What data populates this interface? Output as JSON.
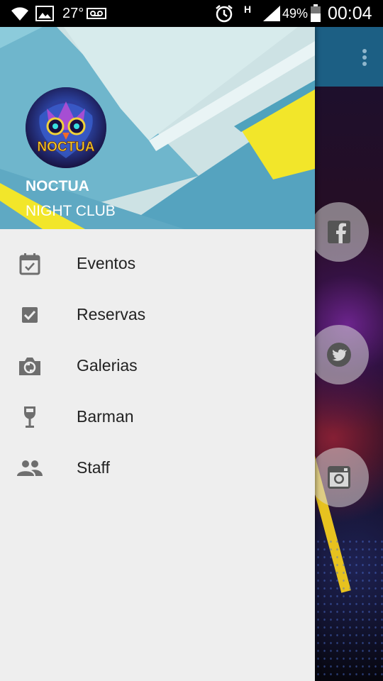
{
  "status_bar": {
    "temperature": "27°",
    "network_type": "H",
    "battery_percent": "49%",
    "time": "00:04",
    "icons": [
      "wifi-icon",
      "image-icon",
      "voicemail-icon",
      "alarm-icon",
      "signal-icon",
      "battery-icon"
    ]
  },
  "drawer": {
    "header": {
      "logo_text": "NOCTUA",
      "title": "NOCTUA",
      "subtitle": "NIGHT CLUB"
    },
    "menu_items": [
      {
        "label": "Eventos",
        "icon": "calendar-check-icon"
      },
      {
        "label": "Reservas",
        "icon": "checkbox-icon"
      },
      {
        "label": "Galerias",
        "icon": "camera-icon"
      },
      {
        "label": "Barman",
        "icon": "wine-glass-icon"
      },
      {
        "label": "Staff",
        "icon": "people-icon"
      }
    ]
  },
  "background_app": {
    "overflow_menu_icon": "more-vert-icon",
    "social_buttons": [
      "facebook-icon",
      "twitter-icon",
      "instagram-icon"
    ]
  },
  "colors": {
    "toolbar": "#1c5f84",
    "drawer_background": "#eeeeee",
    "menu_text": "#222222",
    "menu_icon": "#6e6e6e",
    "header_teal": "#5aa9c4",
    "header_yellow": "#f2e62a"
  }
}
